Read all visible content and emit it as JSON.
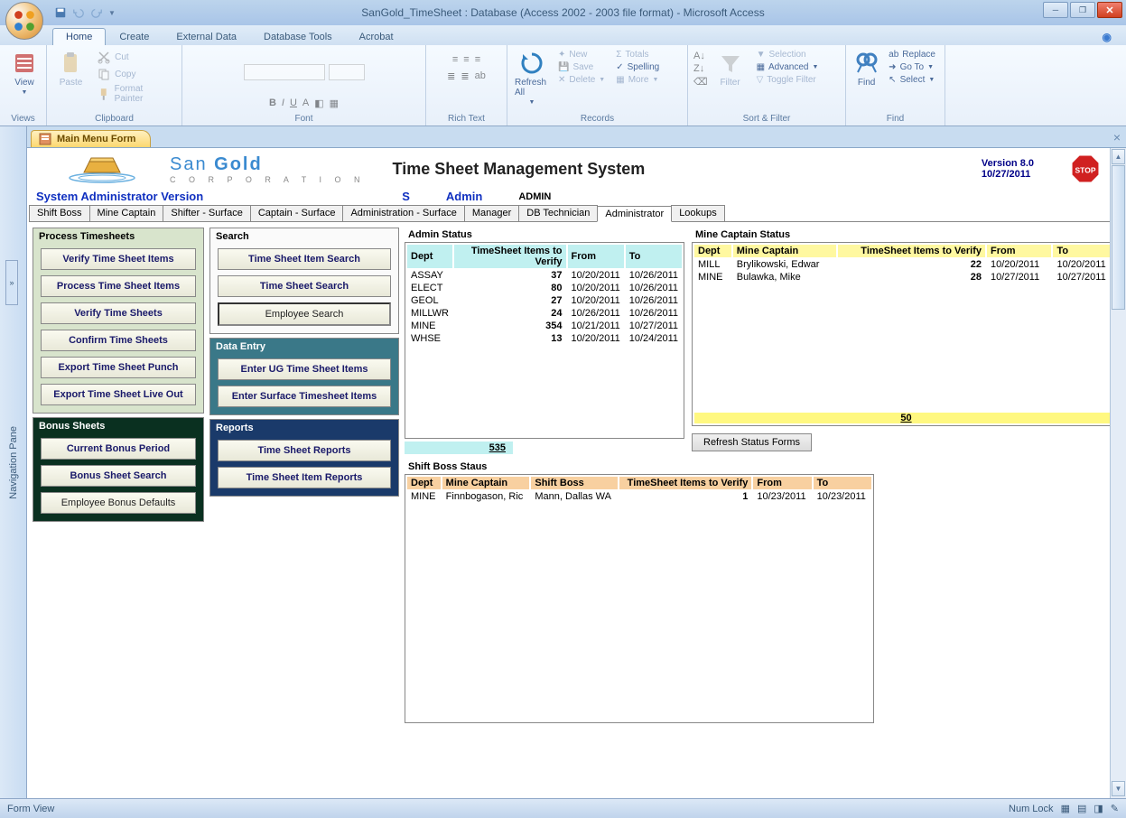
{
  "window": {
    "title": "SanGold_TimeSheet : Database (Access 2002 - 2003 file format) - Microsoft Access"
  },
  "ribbon_tabs": [
    "Home",
    "Create",
    "External Data",
    "Database Tools",
    "Acrobat"
  ],
  "ribbon": {
    "views": {
      "view": "View",
      "group": "Views"
    },
    "clipboard": {
      "paste": "Paste",
      "cut": "Cut",
      "copy": "Copy",
      "fp": "Format Painter",
      "group": "Clipboard"
    },
    "font": {
      "group": "Font"
    },
    "richtext": {
      "group": "Rich Text"
    },
    "records": {
      "refresh": "Refresh All",
      "new": "New",
      "save": "Save",
      "delete": "Delete",
      "totals": "Totals",
      "spelling": "Spelling",
      "more": "More",
      "group": "Records"
    },
    "sortfilter": {
      "filter": "Filter",
      "selection": "Selection",
      "advanced": "Advanced",
      "toggle": "Toggle Filter",
      "group": "Sort & Filter"
    },
    "find": {
      "find": "Find",
      "replace": "Replace",
      "goto": "Go To",
      "select": "Select",
      "group": "Find"
    }
  },
  "navpane": "Navigation Pane",
  "doc_tab": "Main Menu Form",
  "header": {
    "company1": "San",
    "company2": "Gold",
    "corp": "C O R P O R A T I O N",
    "systitle": "Time Sheet Management System",
    "version": "Version 8.0",
    "date": "10/27/2011"
  },
  "info": {
    "sysver": "System Administrator Version",
    "s": "S",
    "admin": "Admin",
    "role": "ADMIN"
  },
  "role_tabs": [
    "Shift Boss",
    "Mine Captain",
    "Shifter - Surface",
    "Captain - Surface",
    "Administration - Surface",
    "Manager",
    "DB Technician",
    "Administrator",
    "Lookups"
  ],
  "process": {
    "title": "Process Timesheets",
    "b1": "Verify Time Sheet Items",
    "b2": "Process Time Sheet Items",
    "b3": "Verify Time Sheets",
    "b4": "Confirm Time Sheets",
    "b5": "Export Time Sheet Punch",
    "b6": "Export Time Sheet Live Out"
  },
  "bonus": {
    "title": "Bonus Sheets",
    "b1": "Current Bonus Period",
    "b2": "Bonus Sheet Search",
    "b3": "Employee Bonus Defaults"
  },
  "search": {
    "title": "Search",
    "b1": "Time Sheet Item Search",
    "b2": "Time Sheet Search",
    "b3": "Employee Search"
  },
  "dataentry": {
    "title": "Data Entry",
    "b1": "Enter UG Time Sheet Items",
    "b2": "Enter Surface Timesheet Items"
  },
  "reports": {
    "title": "Reports",
    "b1": "Time Sheet Reports",
    "b2": "Time Sheet Item Reports"
  },
  "admin_status": {
    "title": "Admin Status",
    "cols": {
      "dept": "Dept",
      "verify": "TimeSheet Items to Verify",
      "from": "From",
      "to": "To"
    },
    "rows": [
      {
        "dept": "ASSAY",
        "n": "37",
        "from": "10/20/2011",
        "to": "10/26/2011"
      },
      {
        "dept": "ELECT",
        "n": "80",
        "from": "10/20/2011",
        "to": "10/26/2011"
      },
      {
        "dept": "GEOL",
        "n": "27",
        "from": "10/20/2011",
        "to": "10/26/2011"
      },
      {
        "dept": "MILLWR",
        "n": "24",
        "from": "10/26/2011",
        "to": "10/26/2011"
      },
      {
        "dept": "MINE",
        "n": "354",
        "from": "10/21/2011",
        "to": "10/27/2011"
      },
      {
        "dept": "WHSE",
        "n": "13",
        "from": "10/20/2011",
        "to": "10/24/2011"
      }
    ],
    "total": "535"
  },
  "captain_status": {
    "title": "Mine Captain Status",
    "cols": {
      "dept": "Dept",
      "cap": "Mine Captain",
      "verify": "TimeSheet Items to Verify",
      "from": "From",
      "to": "To"
    },
    "rows": [
      {
        "dept": "MILL",
        "cap": "Brylikowski, Edwar",
        "n": "22",
        "from": "10/20/2011",
        "to": "10/20/2011"
      },
      {
        "dept": "MINE",
        "cap": "Bulawka, Mike",
        "n": "28",
        "from": "10/27/2011",
        "to": "10/27/2011"
      }
    ],
    "total": "50"
  },
  "refresh_btn": "Refresh Status Forms",
  "shift_status": {
    "title": "Shift Boss Staus",
    "cols": {
      "dept": "Dept",
      "cap": "Mine Captain",
      "sb": "Shift Boss",
      "verify": "TimeSheet Items to Verify",
      "from": "From",
      "to": "To"
    },
    "rows": [
      {
        "dept": "MINE",
        "cap": "Finnbogason, Ric",
        "sb": "Mann, Dallas WA",
        "n": "1",
        "from": "10/23/2011",
        "to": "10/23/2011"
      }
    ]
  },
  "statusbar": {
    "left": "Form View",
    "numlock": "Num Lock"
  }
}
